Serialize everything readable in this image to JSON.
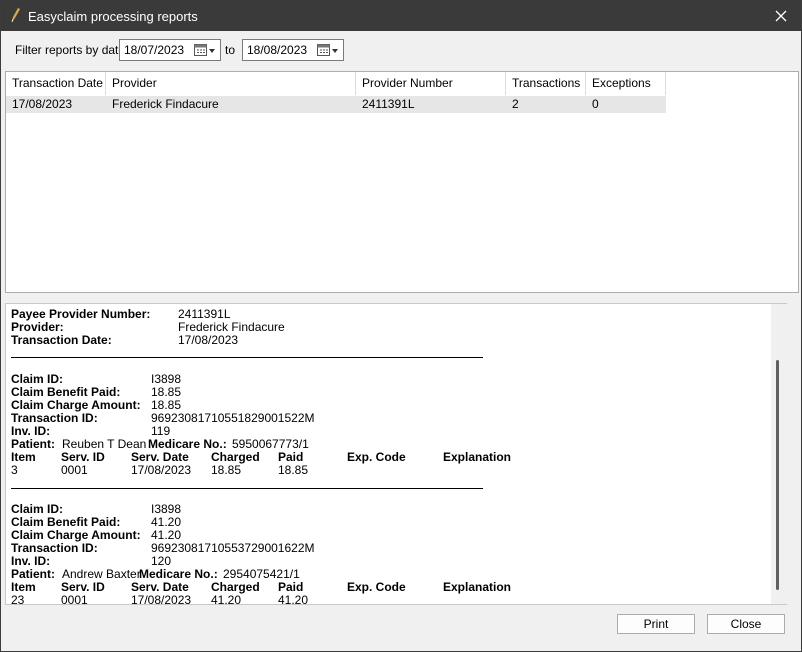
{
  "window": {
    "title": "Easyclaim processing reports"
  },
  "filter": {
    "label": "Filter reports by date:",
    "from": "18/07/2023",
    "to_label": "to",
    "to": "18/08/2023"
  },
  "grid": {
    "headers": [
      "Transaction Date",
      "Provider",
      "Provider Number",
      "Transactions",
      "Exceptions"
    ],
    "rows": [
      [
        "17/08/2023",
        "Frederick Findacure",
        "2411391L",
        "2",
        "0"
      ]
    ]
  },
  "report": {
    "payee_label": "Payee Provider Number:",
    "payee_value": "2411391L",
    "provider_label": "Provider:",
    "provider_value": "Frederick Findacure",
    "tdate_label": "Transaction Date:",
    "tdate_value": "17/08/2023",
    "claims": [
      {
        "claim_id_label": "Claim ID:",
        "claim_id": "I3898",
        "benefit_label": "Claim Benefit Paid:",
        "benefit": "18.85",
        "charge_label": "Claim Charge Amount:",
        "charge": "18.85",
        "txn_label": "Transaction ID:",
        "txn": "96923081710551829001522M",
        "inv_label": "Inv. ID:",
        "inv": "119",
        "patient_label": "Patient:",
        "patient": "Reuben T Dean",
        "medicare_label": "Medicare No.:",
        "medicare": "5950067773/1",
        "cols": [
          "Item",
          "Serv. ID",
          "Serv. Date",
          "Charged",
          "Paid",
          "Exp. Code",
          "Explanation"
        ],
        "values": [
          "3",
          "0001",
          "17/08/2023",
          "18.85",
          "18.85"
        ]
      },
      {
        "claim_id_label": "Claim ID:",
        "claim_id": "I3898",
        "benefit_label": "Claim Benefit Paid:",
        "benefit": "41.20",
        "charge_label": "Claim Charge Amount:",
        "charge": "41.20",
        "txn_label": "Transaction ID:",
        "txn": "96923081710553729001622M",
        "inv_label": "Inv. ID:",
        "inv": "120",
        "patient_label": "Patient:",
        "patient": "Andrew Baxter",
        "medicare_label": "Medicare No.:",
        "medicare": "2954075421/1",
        "cols": [
          "Item",
          "Serv. ID",
          "Serv. Date",
          "Charged",
          "Paid",
          "Exp. Code",
          "Explanation"
        ],
        "values": [
          "23",
          "0001",
          "17/08/2023",
          "41.20",
          "41.20"
        ]
      }
    ]
  },
  "buttons": {
    "print": "Print",
    "close": "Close"
  },
  "icons": {
    "app": "pen-icon",
    "close": "close-icon",
    "calendar": "calendar-dropdown-icon"
  }
}
